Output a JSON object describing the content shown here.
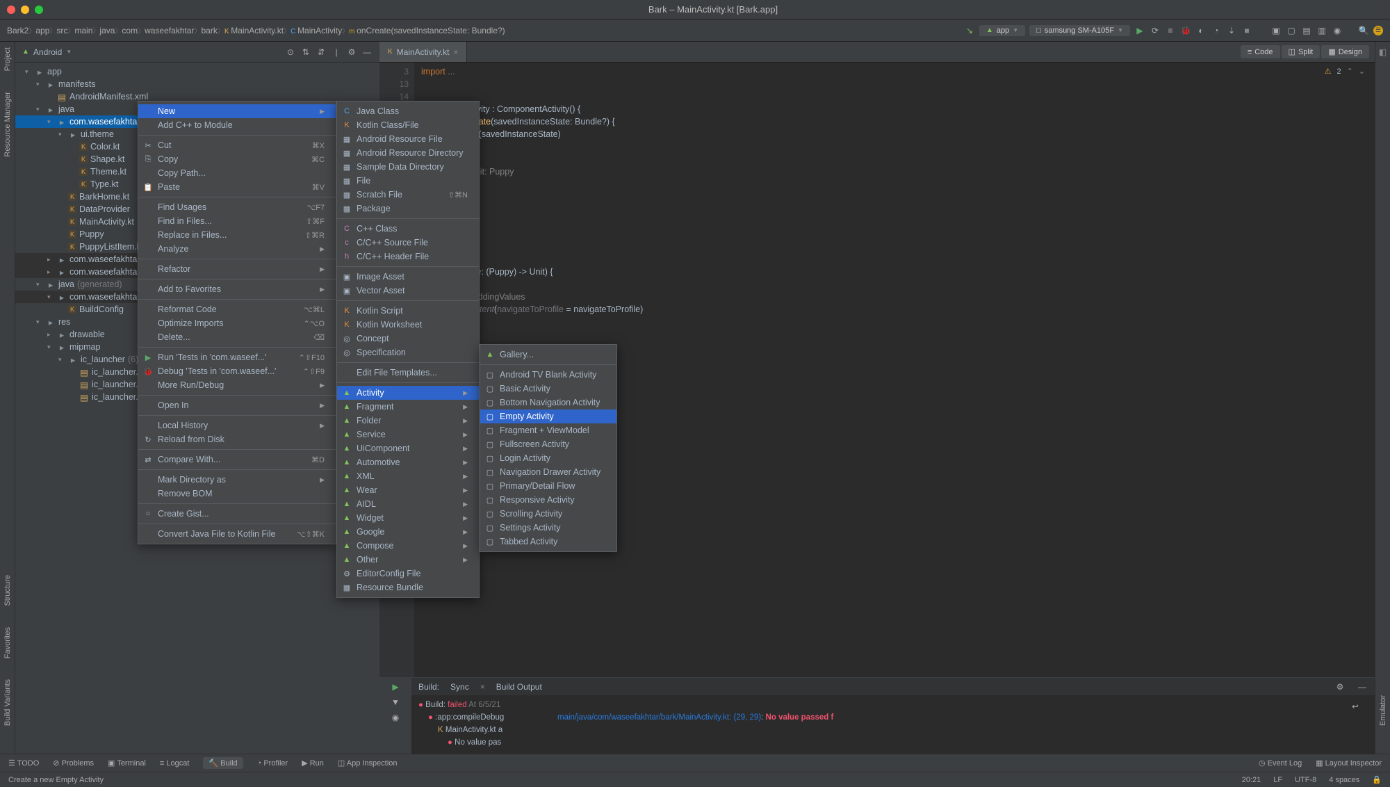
{
  "window": {
    "title": "Bark – MainActivity.kt [Bark.app]"
  },
  "breadcrumb": [
    "Bark2",
    "app",
    "src",
    "main",
    "java",
    "com",
    "waseefakhtar",
    "bark",
    "MainActivity.kt",
    "MainActivity",
    "onCreate(savedInstanceState: Bundle?)"
  ],
  "toolbar": {
    "config": "app",
    "device": "samsung SM-A105F",
    "devicePrefix": "□"
  },
  "project": {
    "header": "Android",
    "tree": [
      {
        "d": 0,
        "a": "v",
        "i": "📁",
        "t": "app"
      },
      {
        "d": 1,
        "a": "v",
        "i": "📁",
        "t": "manifests"
      },
      {
        "d": 2,
        "a": "",
        "i": "📄",
        "t": "AndroidManifest.xml"
      },
      {
        "d": 1,
        "a": "v",
        "i": "📁",
        "t": "java"
      },
      {
        "d": 2,
        "a": "v",
        "i": "📁",
        "t": "com.waseefakhtar.ba",
        "sel": true
      },
      {
        "d": 3,
        "a": "v",
        "i": "📁",
        "t": "ui.theme"
      },
      {
        "d": 4,
        "a": "",
        "i": "K",
        "t": "Color.kt"
      },
      {
        "d": 4,
        "a": "",
        "i": "K",
        "t": "Shape.kt"
      },
      {
        "d": 4,
        "a": "",
        "i": "K",
        "t": "Theme.kt"
      },
      {
        "d": 4,
        "a": "",
        "i": "K",
        "t": "Type.kt"
      },
      {
        "d": 3,
        "a": "",
        "i": "K",
        "t": "BarkHome.kt"
      },
      {
        "d": 3,
        "a": "",
        "i": "K",
        "t": "DataProvider"
      },
      {
        "d": 3,
        "a": "",
        "i": "K",
        "t": "MainActivity.kt"
      },
      {
        "d": 3,
        "a": "",
        "i": "K",
        "t": "Puppy"
      },
      {
        "d": 3,
        "a": "",
        "i": "K",
        "t": "PuppyListItem.kt"
      },
      {
        "d": 2,
        "a": ">",
        "i": "📁",
        "t": "com.waseefakhtar.ba",
        "hl": true
      },
      {
        "d": 2,
        "a": ">",
        "i": "📁",
        "t": "com.waseefakhtar.ba",
        "hl": true
      },
      {
        "d": 1,
        "a": "v",
        "i": "📁",
        "t": "java ",
        "suffix": "(generated)"
      },
      {
        "d": 2,
        "a": "v",
        "i": "📁",
        "t": "com.waseefakhtar.ba",
        "hl": true
      },
      {
        "d": 3,
        "a": "",
        "i": "K",
        "t": "BuildConfig"
      },
      {
        "d": 1,
        "a": "v",
        "i": "📁",
        "t": "res"
      },
      {
        "d": 2,
        "a": ">",
        "i": "📁",
        "t": "drawable"
      },
      {
        "d": 2,
        "a": "v",
        "i": "📁",
        "t": "mipmap"
      },
      {
        "d": 3,
        "a": "v",
        "i": "📁",
        "t": "ic_launcher ",
        "suffix": "(6)"
      },
      {
        "d": 4,
        "a": "",
        "i": "📄",
        "t": "ic_launcher.we"
      },
      {
        "d": 4,
        "a": "",
        "i": "📄",
        "t": "ic_launcher.we"
      },
      {
        "d": 4,
        "a": "",
        "i": "📄",
        "t": "ic_launcher.we"
      }
    ]
  },
  "contextMenu1": [
    {
      "t": "New",
      "sel": true,
      "sub": true
    },
    {
      "t": "Add C++ to Module"
    },
    {
      "sep": true
    },
    {
      "t": "Cut",
      "sc": "⌘X",
      "ico": "✂"
    },
    {
      "t": "Copy",
      "sc": "⌘C",
      "ico": "⎘"
    },
    {
      "t": "Copy Path..."
    },
    {
      "t": "Paste",
      "sc": "⌘V",
      "ico": "📋"
    },
    {
      "sep": true
    },
    {
      "t": "Find Usages",
      "sc": "⌥F7"
    },
    {
      "t": "Find in Files...",
      "sc": "⇧⌘F"
    },
    {
      "t": "Replace in Files...",
      "sc": "⇧⌘R"
    },
    {
      "t": "Analyze",
      "sub": true
    },
    {
      "sep": true
    },
    {
      "t": "Refactor",
      "sub": true
    },
    {
      "sep": true
    },
    {
      "t": "Add to Favorites",
      "sub": true
    },
    {
      "sep": true
    },
    {
      "t": "Reformat Code",
      "sc": "⌥⌘L"
    },
    {
      "t": "Optimize Imports",
      "sc": "⌃⌥O"
    },
    {
      "t": "Delete...",
      "sc": "⌫"
    },
    {
      "sep": true
    },
    {
      "t": "Run 'Tests in 'com.waseef...'",
      "sc": "⌃⇧F10",
      "ico": "▶",
      "icoColor": "#59a869"
    },
    {
      "t": "Debug 'Tests in 'com.waseef...'",
      "sc": "⌃⇧F9",
      "ico": "🐞",
      "icoColor": "#59a869"
    },
    {
      "t": "More Run/Debug",
      "sub": true
    },
    {
      "sep": true
    },
    {
      "t": "Open In",
      "sub": true
    },
    {
      "sep": true
    },
    {
      "t": "Local History",
      "sub": true
    },
    {
      "t": "Reload from Disk",
      "ico": "↻"
    },
    {
      "sep": true
    },
    {
      "t": "Compare With...",
      "sc": "⌘D",
      "ico": "⇄"
    },
    {
      "sep": true
    },
    {
      "t": "Mark Directory as",
      "sub": true
    },
    {
      "t": "Remove BOM"
    },
    {
      "sep": true
    },
    {
      "t": "Create Gist...",
      "ico": "○"
    },
    {
      "sep": true
    },
    {
      "t": "Convert Java File to Kotlin File",
      "sc": "⌥⇧⌘K"
    }
  ],
  "contextMenu2": [
    {
      "t": "Java Class",
      "ico": "C",
      "icoColor": "#4da6ff"
    },
    {
      "t": "Kotlin Class/File",
      "ico": "K",
      "icoColor": "#e88e3c"
    },
    {
      "t": "Android Resource File",
      "ico": "▦"
    },
    {
      "t": "Android Resource Directory",
      "ico": "▦"
    },
    {
      "t": "Sample Data Directory",
      "ico": "▦"
    },
    {
      "t": "File",
      "ico": "▦"
    },
    {
      "t": "Scratch File",
      "sc": "⇧⌘N",
      "ico": "▦"
    },
    {
      "t": "Package",
      "ico": "▦"
    },
    {
      "sep": true
    },
    {
      "t": "C++ Class",
      "ico": "C",
      "icoColor": "#c77dbb"
    },
    {
      "t": "C/C++ Source File",
      "ico": "c",
      "icoColor": "#c77dbb"
    },
    {
      "t": "C/C++ Header File",
      "ico": "h",
      "icoColor": "#c77dbb"
    },
    {
      "sep": true
    },
    {
      "t": "Image Asset",
      "ico": "▣"
    },
    {
      "t": "Vector Asset",
      "ico": "▣"
    },
    {
      "sep": true
    },
    {
      "t": "Kotlin Script",
      "ico": "K",
      "icoColor": "#e88e3c"
    },
    {
      "t": "Kotlin Worksheet",
      "ico": "K",
      "icoColor": "#e88e3c"
    },
    {
      "t": "Concept",
      "ico": "◎"
    },
    {
      "t": "Specification",
      "ico": "◎"
    },
    {
      "sep": true
    },
    {
      "t": "Edit File Templates..."
    },
    {
      "sep": true
    },
    {
      "t": "Activity",
      "sel": true,
      "sub": true,
      "ico": "▲",
      "android": true
    },
    {
      "t": "Fragment",
      "sub": true,
      "ico": "▲",
      "android": true
    },
    {
      "t": "Folder",
      "sub": true,
      "ico": "▲",
      "android": true
    },
    {
      "t": "Service",
      "sub": true,
      "ico": "▲",
      "android": true
    },
    {
      "t": "UiComponent",
      "sub": true,
      "ico": "▲",
      "android": true
    },
    {
      "t": "Automotive",
      "sub": true,
      "ico": "▲",
      "android": true
    },
    {
      "t": "XML",
      "sub": true,
      "ico": "▲",
      "android": true
    },
    {
      "t": "Wear",
      "sub": true,
      "ico": "▲",
      "android": true
    },
    {
      "t": "AIDL",
      "sub": true,
      "ico": "▲",
      "android": true
    },
    {
      "t": "Widget",
      "sub": true,
      "ico": "▲",
      "android": true
    },
    {
      "t": "Google",
      "sub": true,
      "ico": "▲",
      "android": true
    },
    {
      "t": "Compose",
      "sub": true,
      "ico": "▲",
      "android": true
    },
    {
      "t": "Other",
      "sub": true,
      "ico": "▲",
      "android": true
    },
    {
      "t": "EditorConfig File",
      "ico": "⚙"
    },
    {
      "t": "Resource Bundle",
      "ico": "▦"
    }
  ],
  "contextMenu3": [
    {
      "t": "Gallery...",
      "ico": "▲",
      "android": true
    },
    {
      "sep": true
    },
    {
      "t": "Android TV Blank Activity",
      "ico": "▢"
    },
    {
      "t": "Basic Activity",
      "ico": "▢"
    },
    {
      "t": "Bottom Navigation Activity",
      "ico": "▢"
    },
    {
      "t": "Empty Activity",
      "sel": true,
      "ico": "▢"
    },
    {
      "t": "Fragment + ViewModel",
      "ico": "▢"
    },
    {
      "t": "Fullscreen Activity",
      "ico": "▢"
    },
    {
      "t": "Login Activity",
      "ico": "▢"
    },
    {
      "t": "Navigation Drawer Activity",
      "ico": "▢"
    },
    {
      "t": "Primary/Detail Flow",
      "ico": "▢"
    },
    {
      "t": "Responsive Activity",
      "ico": "▢"
    },
    {
      "t": "Scrolling Activity",
      "ico": "▢"
    },
    {
      "t": "Settings Activity",
      "ico": "▢"
    },
    {
      "t": "Tabbed Activity",
      "ico": "▢"
    }
  ],
  "editor": {
    "tab": "MainActivity.kt",
    "views": [
      "Code",
      "Split",
      "Design"
    ],
    "warn": "2",
    "gutter": [
      "3",
      "",
      "13",
      "14"
    ],
    "codeLines": [
      {
        "html": "<span class='kw'>import</span> <span class='comm'>...</span>"
      },
      {
        "html": ""
      },
      {
        "html": ""
      },
      {
        "html": "<span class='kw'>class</span> MainActivity : ComponentActivity() {"
      },
      {
        "html": "        <span class='kw'>fun</span> <span class='fn'>onCreate</span>(savedInstanceState: Bundle?) {"
      },
      {
        "html": "        .onCreate(savedInstanceState)"
      },
      {
        "html": "   <span class='param'>ntent</span> <span class='kw'>{</span>"
      },
      {
        "html": "   <span class='param'>BarkTheme</span> <span class='kw'>{</span>"
      },
      {
        "html": "       <span class='param'>MyApp</span> <span class='kw'>{</span>    <span class='comm'>it: Puppy</span>"
      },
      {
        "html": ""
      },
      {
        "html": "           }"
      },
      {
        "html": ""
      },
      {
        "html": ""
      },
      {
        "html": ""
      },
      {
        "html": ""
      },
      {
        "html": ""
      },
      {
        "html": "   <span class='param'>igateToProfile</span>: (Puppy) -> Unit) {"
      },
      {
        "html": ""
      },
      {
        "html": "   <span class='param'>nt</span> = <span class='kw'>{</span>    <span class='comm'>it: PaddingValues</span>"
      },
      {
        "html": "   <span class='param'>arkHomeContent</span>(<span style='color:#72737a'>navigateToProfile</span> = navigateToProfile)"
      }
    ]
  },
  "build": {
    "tabs": [
      "Sync",
      "Build Output"
    ],
    "rows": [
      {
        "i": "●",
        "c": "#f2536e",
        "t": "Build: ",
        "b": "failed",
        "s": " At 6/5/21"
      },
      {
        "i": "●",
        "c": "#f2536e",
        "t": ":app:compileDebug",
        "pad": 1
      },
      {
        "i": "",
        "t": "MainActivity.kt a",
        "pad": 2,
        "k": true
      },
      {
        "i": "●",
        "c": "#f2536e",
        "t": "No value pas",
        "pad": 3
      }
    ],
    "right": {
      "path": "main/java/com/waseefakhtar/bark/MainActivity.kt: (29, 29)",
      "err": "No value passed f"
    },
    "rightIcons": [
      "⚙",
      "—"
    ]
  },
  "bottomBar": {
    "items": [
      "TODO",
      "Problems",
      "Terminal",
      "Logcat",
      "Build",
      "Profiler",
      "Run",
      "App Inspection"
    ],
    "right": [
      "Event Log",
      "Layout Inspector"
    ]
  },
  "status": {
    "hint": "Create a new Empty Activity",
    "right": [
      "20:21",
      "LF",
      "UTF-8",
      "4 spaces"
    ]
  },
  "leftRail": [
    "Project",
    "Resource Manager"
  ],
  "rightRail": [
    ""
  ],
  "leftRail2": [
    "Structure",
    "Favorites",
    "Build Variants"
  ]
}
